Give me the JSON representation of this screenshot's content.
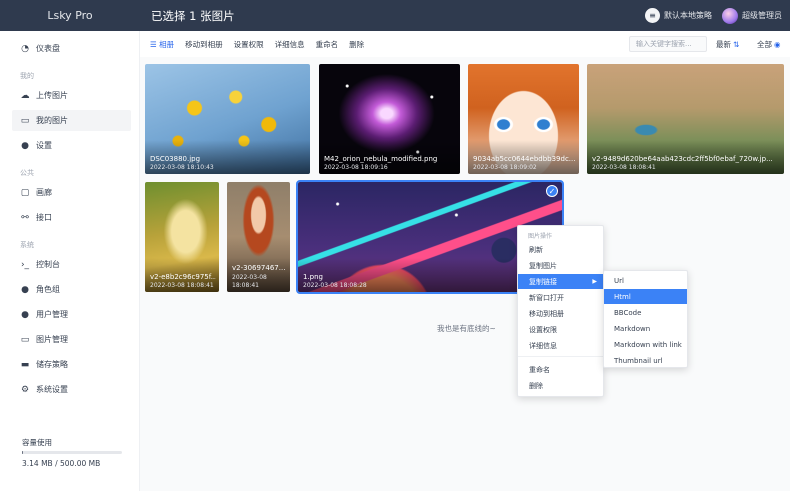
{
  "app": {
    "brand": "Lsky Pro",
    "title": "已选择 1 张图片"
  },
  "topbar": {
    "strategy_label": "默认本地策略",
    "strategy_icon": "database-icon",
    "user_label": "超级管理员"
  },
  "sidebar": {
    "dashboard": "仪表盘",
    "group_mine": "我的",
    "upload": "上传图片",
    "my_images": "我的图片",
    "settings": "设置",
    "group_public": "公共",
    "gallery": "画廊",
    "api": "接口",
    "group_system": "系统",
    "console": "控制台",
    "roles": "角色组",
    "users": "用户管理",
    "images": "图片管理",
    "strategies": "储存策略",
    "system_settings": "系统设置",
    "storage_label": "容量使用",
    "storage_text": "3.14 MB / 500.00 MB",
    "storage_used_fraction": 0.00628
  },
  "toolbar": {
    "albums": "相册",
    "move": "移动到相册",
    "permission": "设置权限",
    "details": "详细信息",
    "rename": "重命名",
    "delete": "删除",
    "search_placeholder": "输入关键字搜索...",
    "sort": "最新",
    "filter": "全部"
  },
  "images": [
    {
      "name": "DSC03880.jpg",
      "date": "2022-03-08 18:10:43"
    },
    {
      "name": "M42_orion_nebula_modified.png",
      "date": "2022-03-08 18:09:16"
    },
    {
      "name": "9034ab5cc0644ebdbb39dc...",
      "date": "2022-03-08 18:09:02"
    },
    {
      "name": "v2-9489d620be64aab423cdc2ff5bf0ebaf_720w.jp...",
      "date": "2022-03-08 18:08:41"
    },
    {
      "name": "v2-e8b2c96c975f...",
      "date": "2022-03-08 18:08:41"
    },
    {
      "name": "v2-30697467...",
      "date_line1": "2022-03-08",
      "date_line2": "18:08:41"
    },
    {
      "name": "1.png",
      "date": "2022-03-08 18:08:28"
    }
  ],
  "empty_message": "我也是有底线的~",
  "context_menu": {
    "title": "图片操作",
    "refresh": "刷新",
    "copy_image": "复制图片",
    "copy_link": "复制链接",
    "open_new": "新窗口打开",
    "move": "移动到相册",
    "permission": "设置权限",
    "details": "详细信息",
    "rename": "重命名",
    "delete": "删除"
  },
  "submenu": {
    "url": "Url",
    "html": "Html",
    "bbcode": "BBCode",
    "markdown": "Markdown",
    "markdown_link": "Markdown with link",
    "thumbnail": "Thumbnail url"
  }
}
